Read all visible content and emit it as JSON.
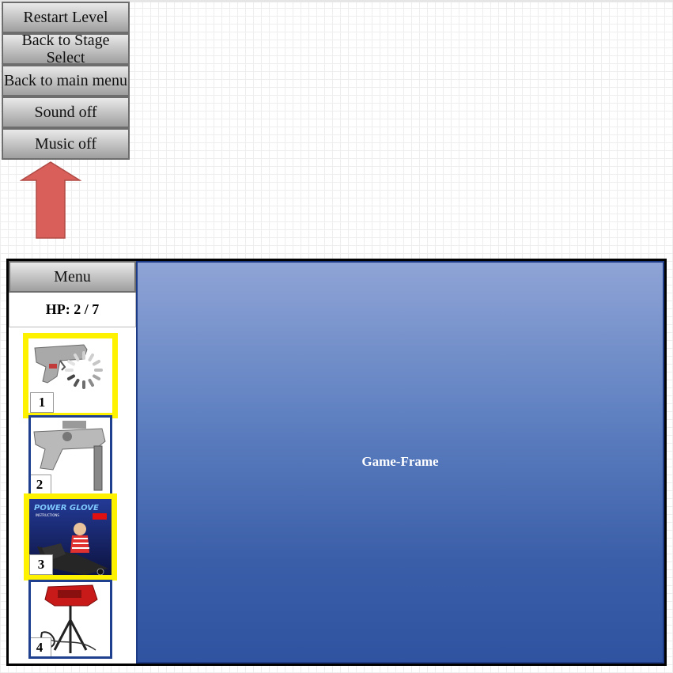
{
  "dropdown_menu": {
    "items": [
      {
        "label": "Restart Level"
      },
      {
        "label": "Back to Stage Select"
      },
      {
        "label": "Back to main menu"
      },
      {
        "label": "Sound off"
      },
      {
        "label": "Music off"
      }
    ],
    "arrow_icon": "arrow-up-icon",
    "arrow_color": "#d9605a"
  },
  "sidebar": {
    "menu_label": "Menu",
    "hp": {
      "label": "HP: 2 / 7"
    },
    "items": [
      {
        "number": "1",
        "icon": "zapper-gun-icon",
        "selected": true,
        "status": "loading"
      },
      {
        "number": "2",
        "icon": "super-scope-icon",
        "selected": false
      },
      {
        "number": "3",
        "icon": "power-glove-icon",
        "selected": true,
        "art_text": "POWER GLOVE",
        "art_subtext": "INSTRUCTIONS"
      },
      {
        "number": "4",
        "icon": "virtual-boy-icon",
        "selected": false
      }
    ]
  },
  "game_frame": {
    "label": "Game-Frame"
  },
  "colors": {
    "selection_highlight": "#fff200",
    "item_border": "#1f3f8f",
    "game_frame_top": "#8fa4d6",
    "game_frame_bottom": "#2f53a0"
  }
}
